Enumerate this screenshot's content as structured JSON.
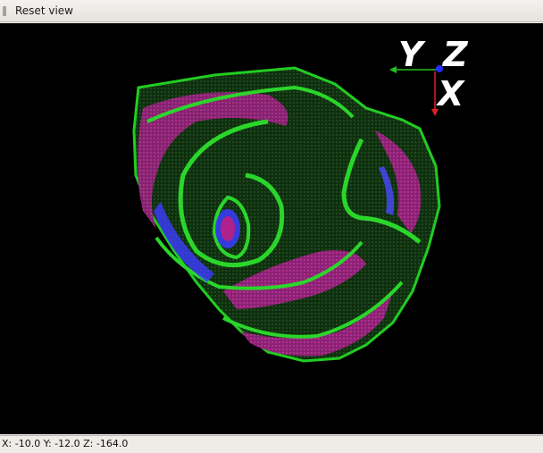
{
  "toolbar": {
    "reset_label": "Reset view"
  },
  "axes": {
    "y_label": "Y",
    "z_label": "Z",
    "x_label": "X"
  },
  "status": {
    "coordinates": "X: -10.0 Y: -12.0 Z: -164.0"
  },
  "colors": {
    "background": "#000000",
    "green": "#2bd62b",
    "dark_green": "#123a12",
    "magenta": "#b0208a",
    "blue": "#3c3cff",
    "x_axis": "#e02020",
    "y_axis": "#20c020",
    "z_axis": "#2030ff"
  }
}
